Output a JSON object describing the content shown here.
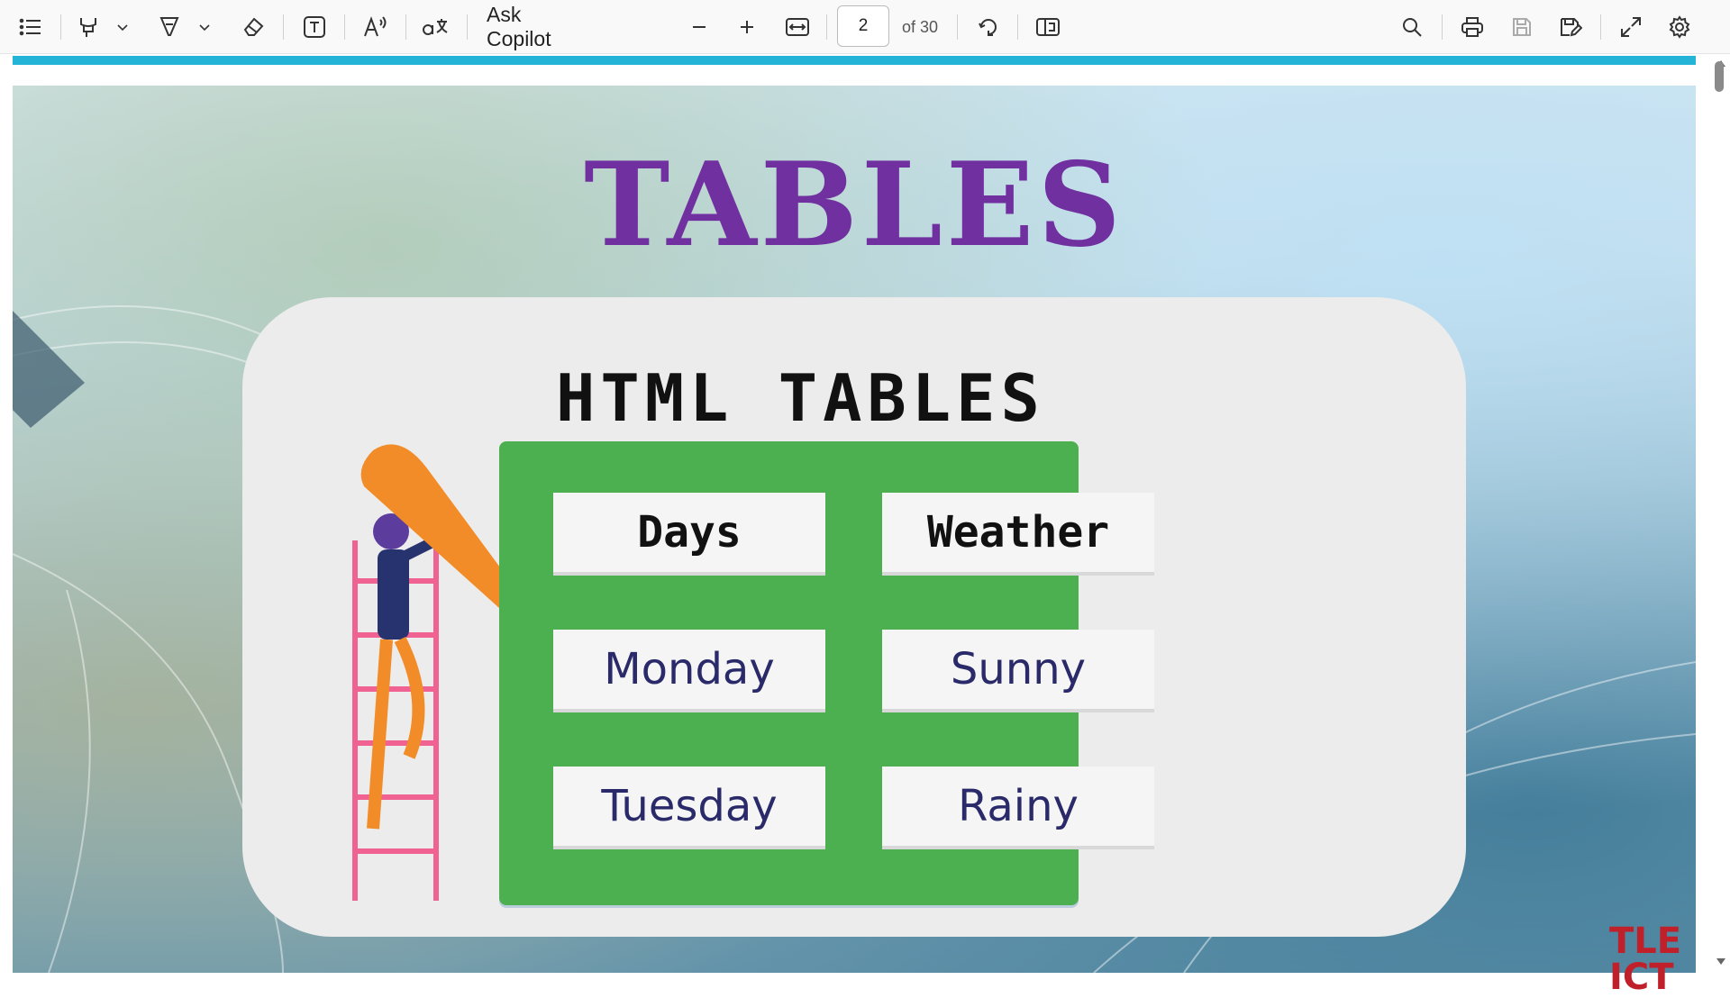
{
  "toolbar": {
    "ask_copilot": "Ask Copilot",
    "page_number": "2",
    "page_total": "of 30"
  },
  "slide": {
    "title": "TABLES",
    "subtitle": "HTML TABLES",
    "logo_text": "TLE ICT",
    "table": {
      "headers": [
        "Days",
        "Weather"
      ],
      "rows": [
        [
          "Monday",
          "Sunny"
        ],
        [
          "Tuesday",
          "Rainy"
        ]
      ]
    }
  },
  "colors": {
    "accent_strip": "#23b4d8",
    "title": "#7030a0",
    "board": "#4caf50"
  }
}
